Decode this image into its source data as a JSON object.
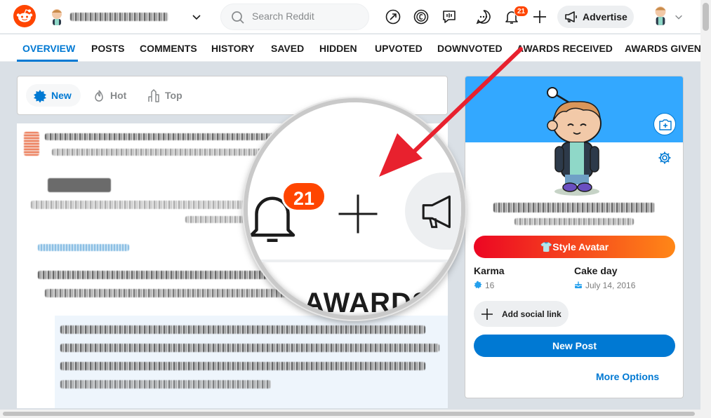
{
  "header": {
    "search_placeholder": "Search Reddit",
    "notifications_count": "21",
    "advertise_label": "Advertise"
  },
  "tabs": [
    {
      "label": "OVERVIEW"
    },
    {
      "label": "POSTS"
    },
    {
      "label": "COMMENTS"
    },
    {
      "label": "HISTORY"
    },
    {
      "label": "SAVED"
    },
    {
      "label": "HIDDEN"
    },
    {
      "label": "UPVOTED"
    },
    {
      "label": "DOWNVOTED"
    },
    {
      "label": "AWARDS RECEIVED"
    },
    {
      "label": "AWARDS GIVEN"
    }
  ],
  "sort": {
    "new": "New",
    "hot": "Hot",
    "top": "Top"
  },
  "magnifier": {
    "badge": "21",
    "tab_fragment": "AWARDS"
  },
  "profile": {
    "style_avatar": "Style Avatar",
    "karma_label": "Karma",
    "karma_value": "16",
    "cakeday_label": "Cake day",
    "cakeday_value": "July 14, 2016",
    "social_link": "Add social link",
    "new_post": "New Post",
    "more_options": "More Options"
  },
  "colors": {
    "accent": "#0079d3",
    "brand": "#ff4500",
    "banner": "#33a8ff",
    "arrow": "#e8212e"
  }
}
